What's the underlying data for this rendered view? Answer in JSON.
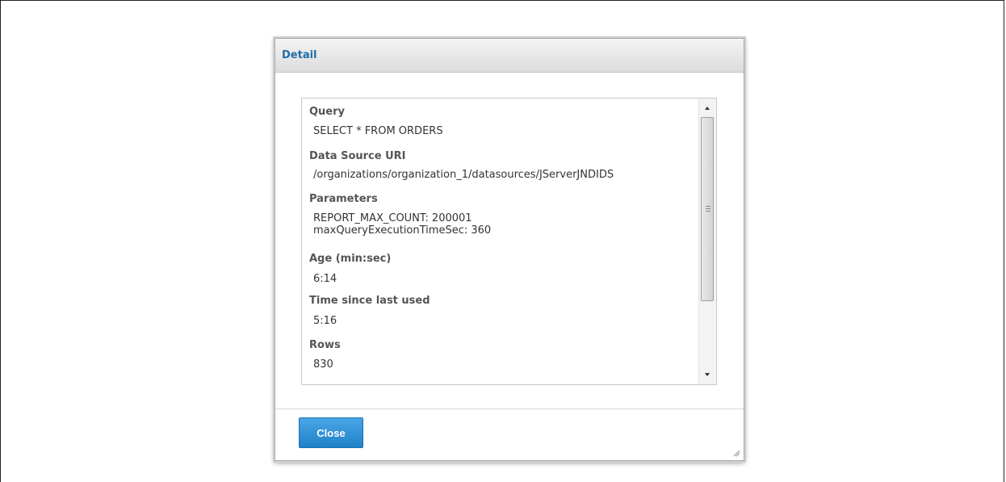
{
  "dialog": {
    "title": "Detail",
    "fields": [
      {
        "label": "Query",
        "value": "SELECT * FROM ORDERS"
      },
      {
        "label": "Data Source URI",
        "value": "/organizations/organization_1/datasources/JServerJNDIDS"
      },
      {
        "label": "Parameters",
        "value": "REPORT_MAX_COUNT: 200001\nmaxQueryExecutionTimeSec: 360"
      },
      {
        "label": "Age (min:sec)",
        "value": "6:14"
      },
      {
        "label": "Time since last used",
        "value": "5:16"
      },
      {
        "label": "Rows",
        "value": "830"
      }
    ],
    "close_label": "Close"
  },
  "icons": {
    "scroll_up": "chevron-up-icon",
    "scroll_down": "chevron-down-icon",
    "resize": "resize-grip-icon"
  },
  "colors": {
    "title": "#1f6ea8",
    "button": "#2a8fd6",
    "label": "#555555"
  }
}
